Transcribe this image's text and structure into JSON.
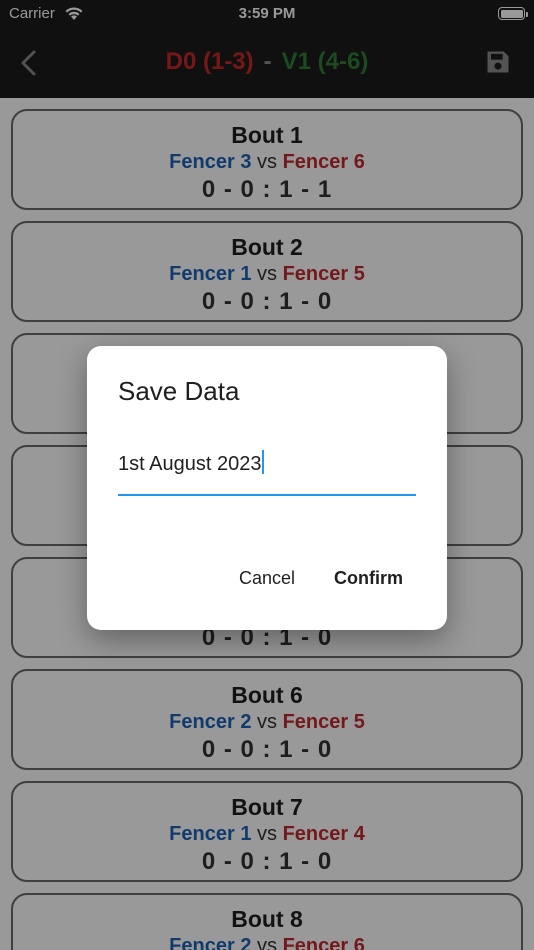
{
  "status_bar": {
    "carrier": "Carrier",
    "time": "3:59 PM"
  },
  "header": {
    "left_team": "D0 (1-3)",
    "separator": "-",
    "right_team": "V1 (4-6)"
  },
  "bouts": [
    {
      "title": "Bout 1",
      "fencer_a": "Fencer 3",
      "vs": "vs",
      "fencer_b": "Fencer 6",
      "score": "0 - 0 : 1 - 1"
    },
    {
      "title": "Bout 2",
      "fencer_a": "Fencer 1",
      "vs": "vs",
      "fencer_b": "Fencer 5",
      "score": "0 - 0 : 1 - 0"
    },
    {
      "title": "",
      "fencer_a": "",
      "vs": "",
      "fencer_b": "",
      "score": ""
    },
    {
      "title": "",
      "fencer_a": "",
      "vs": "",
      "fencer_b": "",
      "score": ""
    },
    {
      "title": "",
      "fencer_a": "",
      "vs": "",
      "fencer_b": "",
      "score": "0 - 0 : 1 - 0"
    },
    {
      "title": "Bout 6",
      "fencer_a": "Fencer 2",
      "vs": "vs",
      "fencer_b": "Fencer 5",
      "score": "0 - 0 : 1 - 0"
    },
    {
      "title": "Bout 7",
      "fencer_a": "Fencer 1",
      "vs": "vs",
      "fencer_b": "Fencer 4",
      "score": "0 - 0 : 1 - 0"
    },
    {
      "title": "Bout 8",
      "fencer_a": "Fencer 2",
      "vs": "vs",
      "fencer_b": "Fencer 6",
      "score": ""
    }
  ],
  "dialog": {
    "title": "Save Data",
    "input_value": "1st August 2023",
    "cancel_label": "Cancel",
    "confirm_label": "Confirm"
  },
  "colors": {
    "accent": "#2196f3",
    "fencer_a": "#1e63b6",
    "fencer_b": "#c0282d",
    "header_left": "#c62828",
    "header_right": "#2e7d32"
  },
  "icons": {
    "back": "chevron-left-icon",
    "save": "floppy-disk-icon",
    "wifi": "wifi-icon",
    "battery": "battery-icon"
  }
}
